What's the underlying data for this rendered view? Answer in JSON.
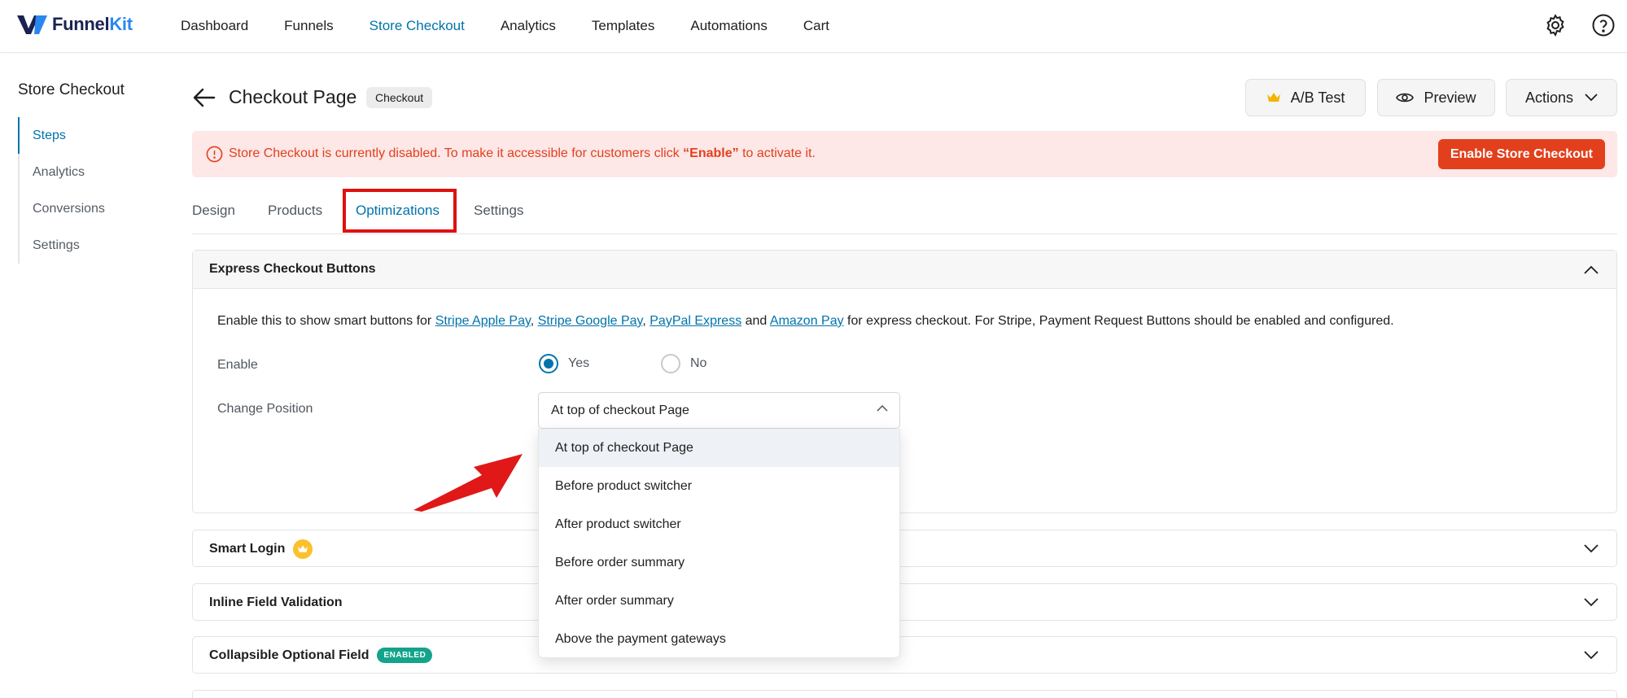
{
  "brand": {
    "name_part1": "Funnel",
    "name_part2": "Kit",
    "accent": "#0073aa",
    "danger": "#e2401c"
  },
  "nav": {
    "items": [
      {
        "label": "Dashboard",
        "active": false
      },
      {
        "label": "Funnels",
        "active": false
      },
      {
        "label": "Store Checkout",
        "active": true
      },
      {
        "label": "Analytics",
        "active": false
      },
      {
        "label": "Templates",
        "active": false
      },
      {
        "label": "Automations",
        "active": false
      },
      {
        "label": "Cart",
        "active": false
      }
    ],
    "icons": [
      "gear-icon",
      "help-icon"
    ]
  },
  "sidebar": {
    "title": "Store Checkout",
    "items": [
      {
        "label": "Steps",
        "active": true
      },
      {
        "label": "Analytics",
        "active": false
      },
      {
        "label": "Conversions",
        "active": false
      },
      {
        "label": "Settings",
        "active": false
      }
    ]
  },
  "header": {
    "title": "Checkout Page",
    "badge": "Checkout",
    "ab_test_label": "A/B Test",
    "preview_label": "Preview",
    "actions_label": "Actions"
  },
  "notice": {
    "text_before": "Store Checkout is currently disabled. To make it accessible for customers click ",
    "text_bold": "“Enable”",
    "text_after": " to activate it.",
    "button_label": "Enable Store Checkout"
  },
  "tabs": [
    {
      "label": "Design",
      "active": false
    },
    {
      "label": "Products",
      "active": false
    },
    {
      "label": "Optimizations",
      "active": true
    },
    {
      "label": "Settings",
      "active": false
    }
  ],
  "express": {
    "title": "Express Checkout Buttons",
    "desc_prefix": "Enable this to show smart buttons for ",
    "links": [
      "Stripe Apple Pay",
      "Stripe Google Pay",
      "PayPal Express",
      "Amazon Pay"
    ],
    "sep1": ", ",
    "sep2": ", ",
    "sep3": " and ",
    "desc_suffix": " for express checkout. For Stripe, Payment Request Buttons should be enabled and configured.",
    "enable_label": "Enable",
    "yes_label": "Yes",
    "no_label": "No",
    "enable_value": "Yes",
    "position_label": "Change Position",
    "position_value": "At top of checkout Page",
    "position_options": [
      "At top of checkout Page",
      "Before product switcher",
      "After product switcher",
      "Before order summary",
      "After order summary",
      "Above the payment gateways"
    ]
  },
  "panels": {
    "smart_login": "Smart Login",
    "inline_validation": "Inline Field Validation",
    "collapsible": "Collapsible Optional Field",
    "collapsible_badge": "ENABLED"
  }
}
